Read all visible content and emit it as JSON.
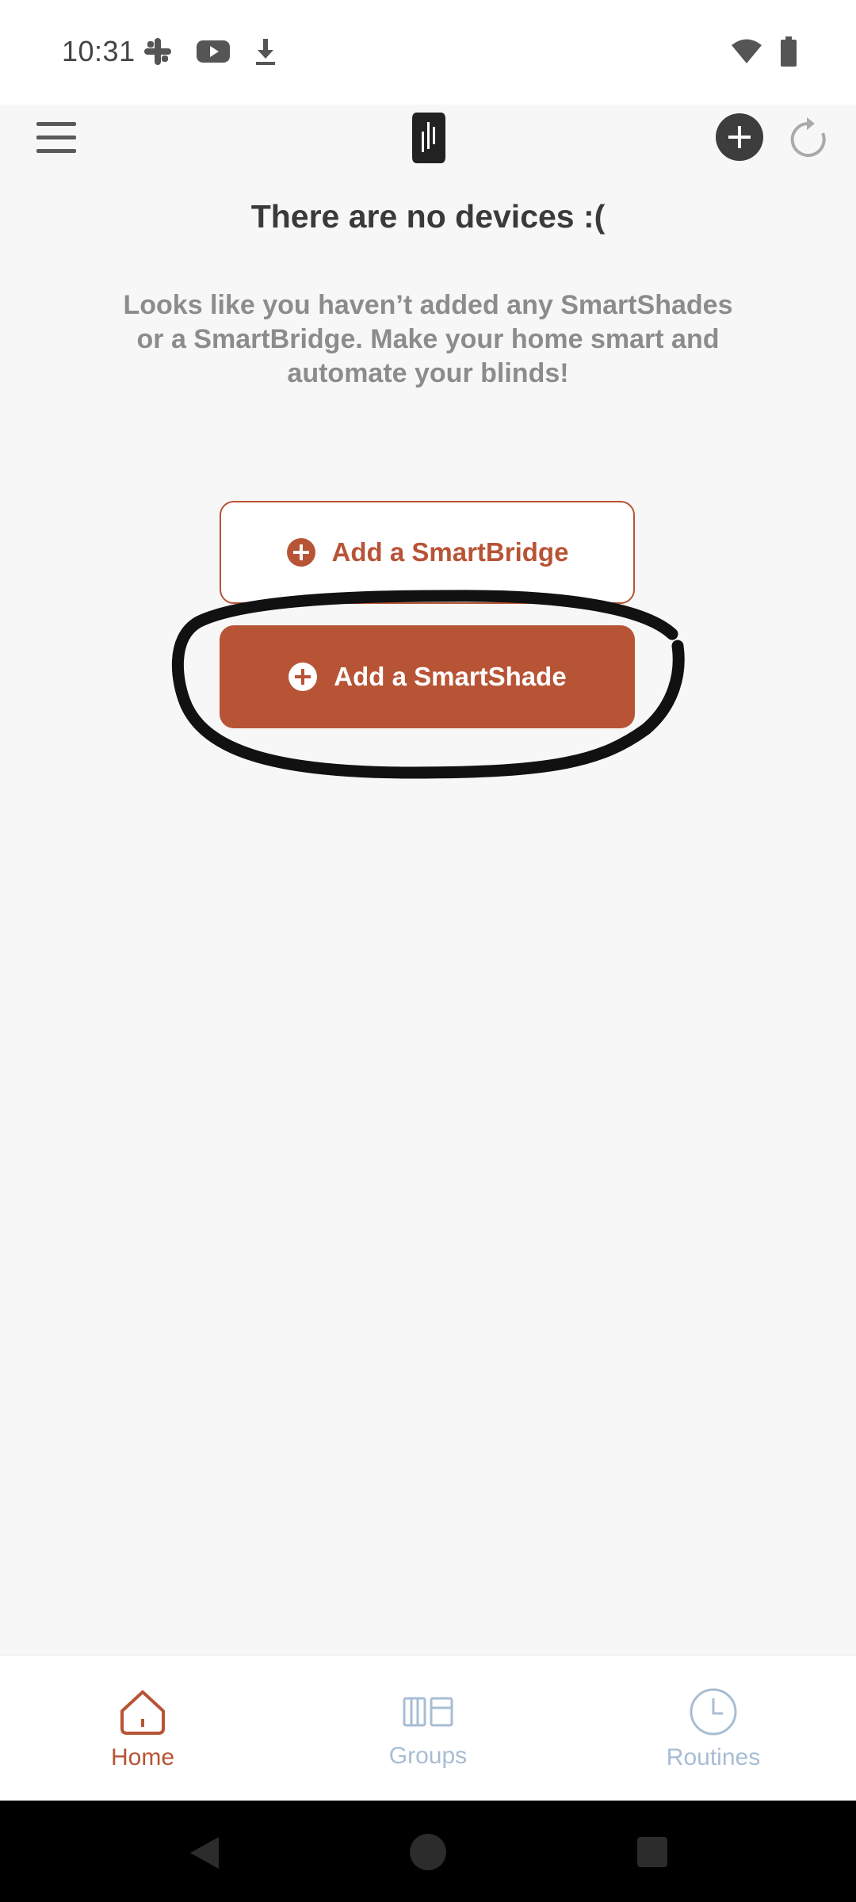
{
  "status_bar": {
    "time": "10:31",
    "left_icons": [
      "slack-icon",
      "youtube-icon",
      "download-icon"
    ],
    "right_icons": [
      "wifi-icon",
      "battery-icon"
    ]
  },
  "app_bar": {
    "menu_icon": "hamburger-menu-icon",
    "logo_icon": "app-logo-icon",
    "add_icon": "add-circle-icon",
    "refresh_icon": "refresh-icon"
  },
  "main": {
    "title": "There are no devices :(",
    "description": "Looks like you haven’t added any SmartShades or a SmartBridge. Make your home smart and automate your blinds!",
    "add_bridge_label": "Add a SmartBridge",
    "add_shade_label": "Add a SmartShade"
  },
  "bottom_nav": {
    "home": "Home",
    "groups": "Groups",
    "routines": "Routines"
  },
  "colors": {
    "accent": "#b85436",
    "inactive_nav": "#a8bdd4",
    "title_text": "#3a3a3a",
    "muted_text": "#8c8c8c"
  }
}
